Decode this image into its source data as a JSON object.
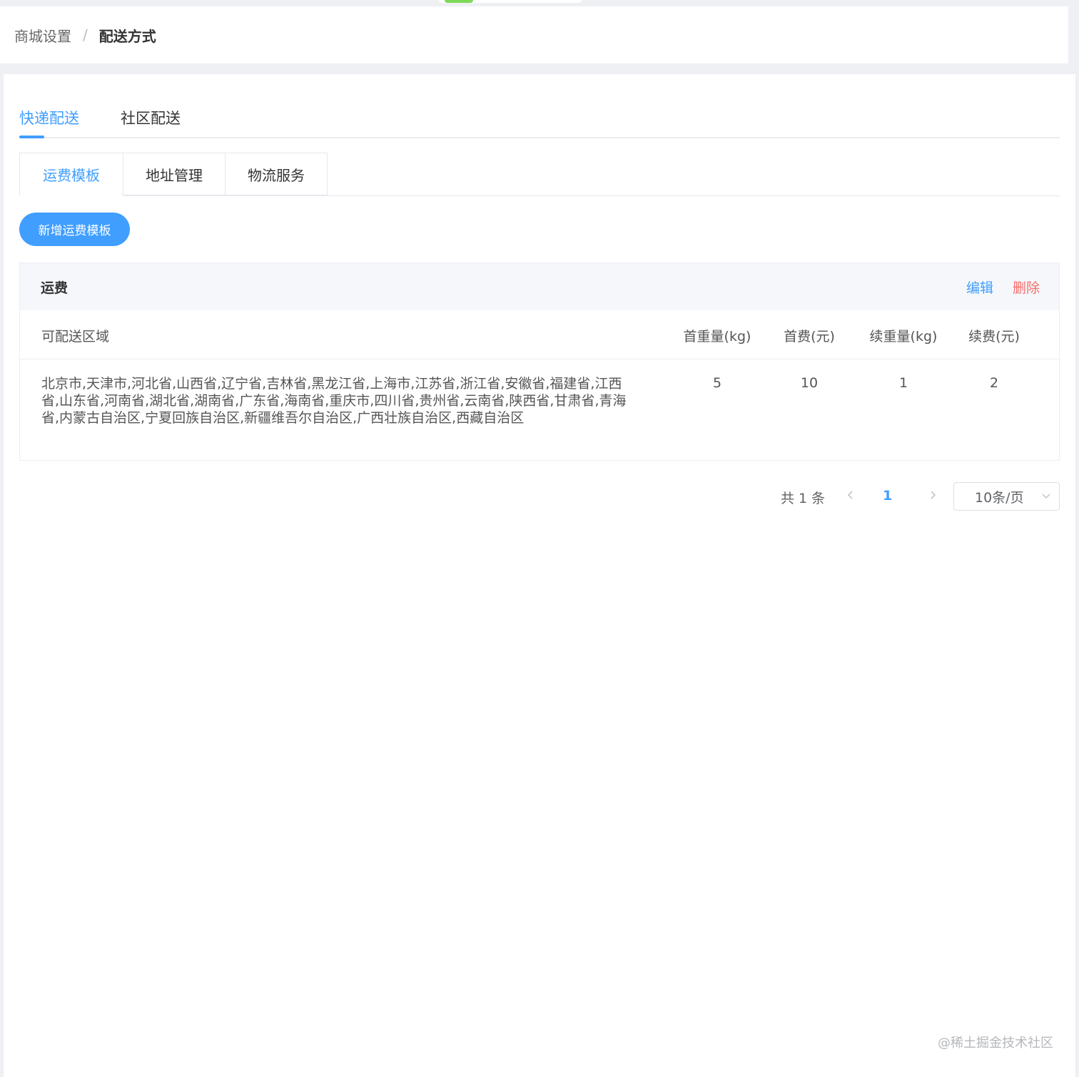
{
  "breadcrumb": {
    "parent": "商城设置",
    "separator": "/",
    "current": "配送方式"
  },
  "top_tabs": [
    {
      "label": "快递配送",
      "active": true
    },
    {
      "label": "社区配送",
      "active": false
    }
  ],
  "sub_tabs": [
    {
      "label": "运费模板",
      "active": true
    },
    {
      "label": "地址管理",
      "active": false
    },
    {
      "label": "物流服务",
      "active": false
    }
  ],
  "add_button_label": "新增运费模板",
  "template": {
    "title": "运费",
    "edit_label": "编辑",
    "delete_label": "删除",
    "columns": [
      "可配送区域",
      "首重量(kg)",
      "首费(元)",
      "续重量(kg)",
      "续费(元)"
    ],
    "rows": [
      {
        "area": "北京市,天津市,河北省,山西省,辽宁省,吉林省,黑龙江省,上海市,江苏省,浙江省,安徽省,福建省,江西省,山东省,河南省,湖北省,湖南省,广东省,海南省,重庆市,四川省,贵州省,云南省,陕西省,甘肃省,青海省,内蒙古自治区,宁夏回族自治区,新疆维吾尔自治区,广西壮族自治区,西藏自治区",
        "first_weight": "5",
        "first_fee": "10",
        "next_weight": "1",
        "next_fee": "2"
      }
    ]
  },
  "pagination": {
    "total": "共 1 条",
    "current_page": "1",
    "page_size": "10条/页"
  },
  "watermark": "@稀土掘金技术社区",
  "colors": {
    "accent": "#409eff",
    "danger": "#f56c6c"
  }
}
